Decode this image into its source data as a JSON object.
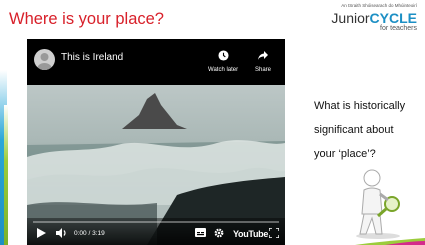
{
  "slide": {
    "title": "Where is your place?",
    "question_lines": [
      "What is historically",
      "significant about",
      "your ‘place’?"
    ]
  },
  "brand": {
    "tagline": "An tSraith Shóisearach do Mhúinteoirí",
    "logo_junior": "Junior",
    "logo_cycle": "CYCLE",
    "logo_sub": "for teachers"
  },
  "video": {
    "title": "This is Ireland",
    "watch_later_label": "Watch later",
    "share_label": "Share",
    "time": "0:00 / 3:19",
    "progress": 0.0,
    "brand_label": "YouTube",
    "icons": [
      "play-icon",
      "volume-icon",
      "subtitles-icon",
      "settings-icon",
      "fullscreen-icon",
      "clock-icon",
      "share-icon"
    ]
  },
  "colors": {
    "title": "#d8202a",
    "brand_cycle": "#1c8fc4",
    "progress": "#ff0000"
  }
}
